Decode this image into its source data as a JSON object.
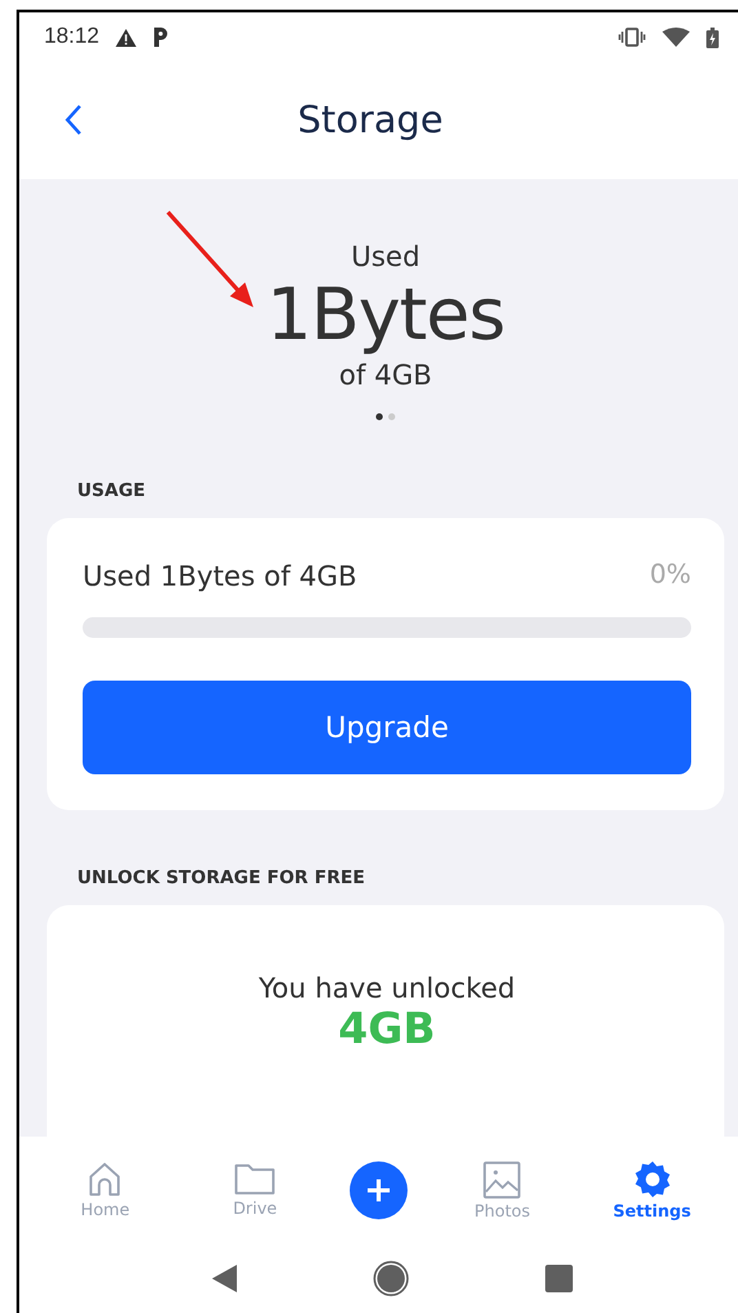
{
  "status_bar": {
    "time": "18:12"
  },
  "header": {
    "title": "Storage"
  },
  "hero": {
    "label": "Used",
    "amount": "1Bytes",
    "total": "of 4GB",
    "dots": [
      {
        "selected": true
      },
      {
        "selected": false
      }
    ]
  },
  "usage": {
    "heading": "USAGE",
    "text": "Used 1Bytes of 4GB",
    "percent": "0%",
    "level": 0.0,
    "button": "Upgrade"
  },
  "unlock": {
    "heading": "UNLOCK STORAGE FOR FREE",
    "text": "You have unlocked",
    "amount": "4GB"
  },
  "nav": [
    {
      "label": "Home",
      "kind": "home",
      "selected": false
    },
    {
      "label": "Drive",
      "kind": "folder",
      "selected": false
    },
    {
      "label": "Photos",
      "kind": "image",
      "selected": false
    },
    {
      "label": "Settings",
      "kind": "gear",
      "selected": true
    }
  ]
}
